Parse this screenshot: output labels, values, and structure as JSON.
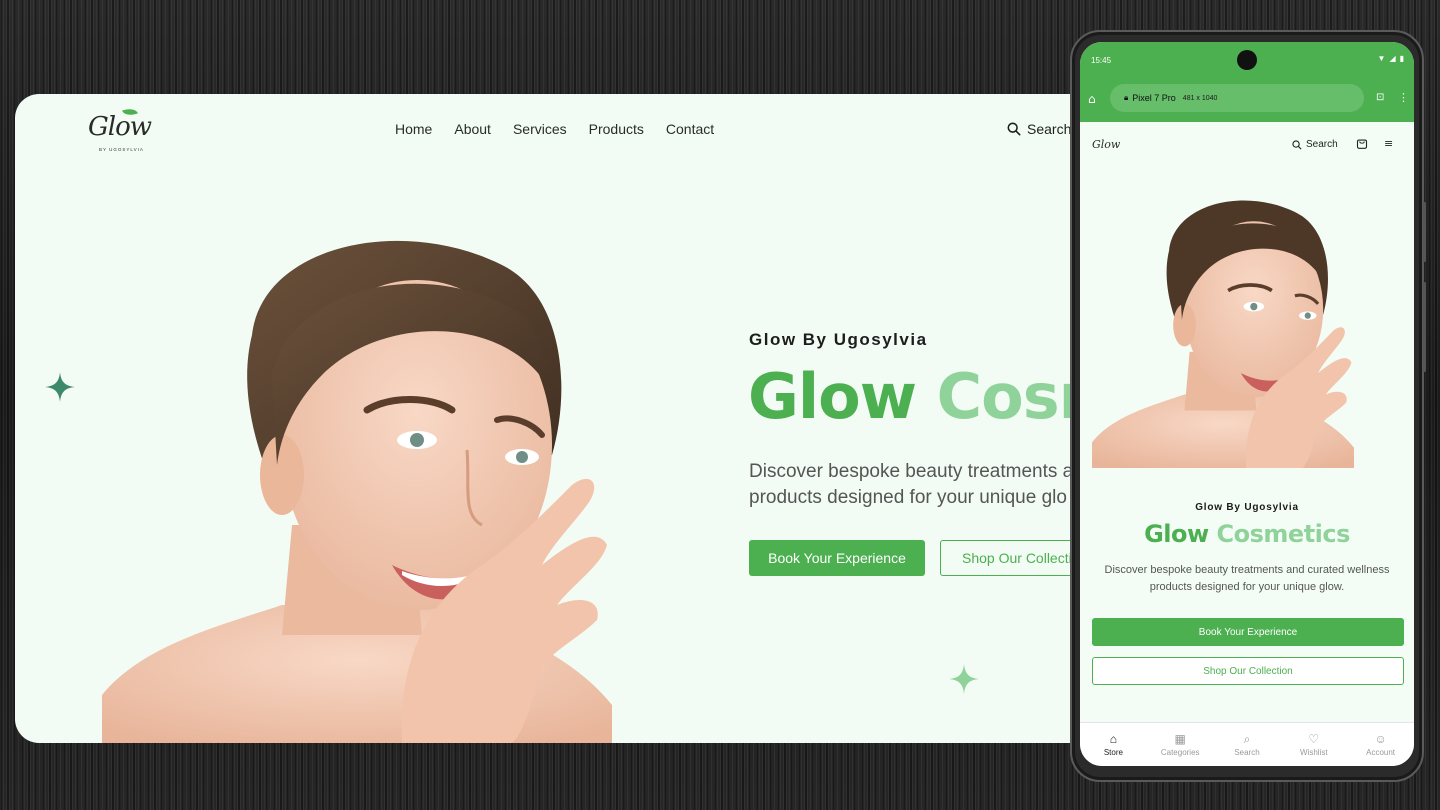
{
  "desktop": {
    "logo": {
      "word": "Glow",
      "sub": "BY UGOSYLVIA"
    },
    "nav": [
      "Home",
      "About",
      "Services",
      "Products",
      "Contact"
    ],
    "search_label": "Search",
    "hero": {
      "eyebrow": "Glow By Ugosylvia",
      "title_part1": "Glow",
      "title_part2": "Cosn",
      "description_line1": "Discover bespoke beauty treatments a",
      "description_line2": "products designed for your unique glo",
      "primary_button": "Book Your Experience",
      "secondary_button": "Shop Our Collecti"
    }
  },
  "phone": {
    "status": {
      "time": "15:45"
    },
    "browser": {
      "device": "Pixel 7 Pro",
      "dimensions": "481 x 1040"
    },
    "header": {
      "logo": "Glow",
      "search_label": "Search"
    },
    "hero": {
      "eyebrow": "Glow By Ugosylvia",
      "title_part1": "Glow",
      "title_part2": "Cosmetics",
      "description": "Discover bespoke beauty treatments and curated wellness products designed for your unique glow.",
      "primary_button": "Book Your Experience",
      "secondary_button": "Shop Our Collection"
    },
    "bottom_nav": [
      {
        "label": "Store",
        "icon": "store-icon"
      },
      {
        "label": "Categories",
        "icon": "grid-icon"
      },
      {
        "label": "Search",
        "icon": "search-icon"
      },
      {
        "label": "Wishlist",
        "icon": "heart-icon"
      },
      {
        "label": "Account",
        "icon": "user-icon"
      }
    ]
  },
  "colors": {
    "brand_green": "#4caf50",
    "light_green": "#8fd39a",
    "page_bg": "#f2fcf4"
  }
}
